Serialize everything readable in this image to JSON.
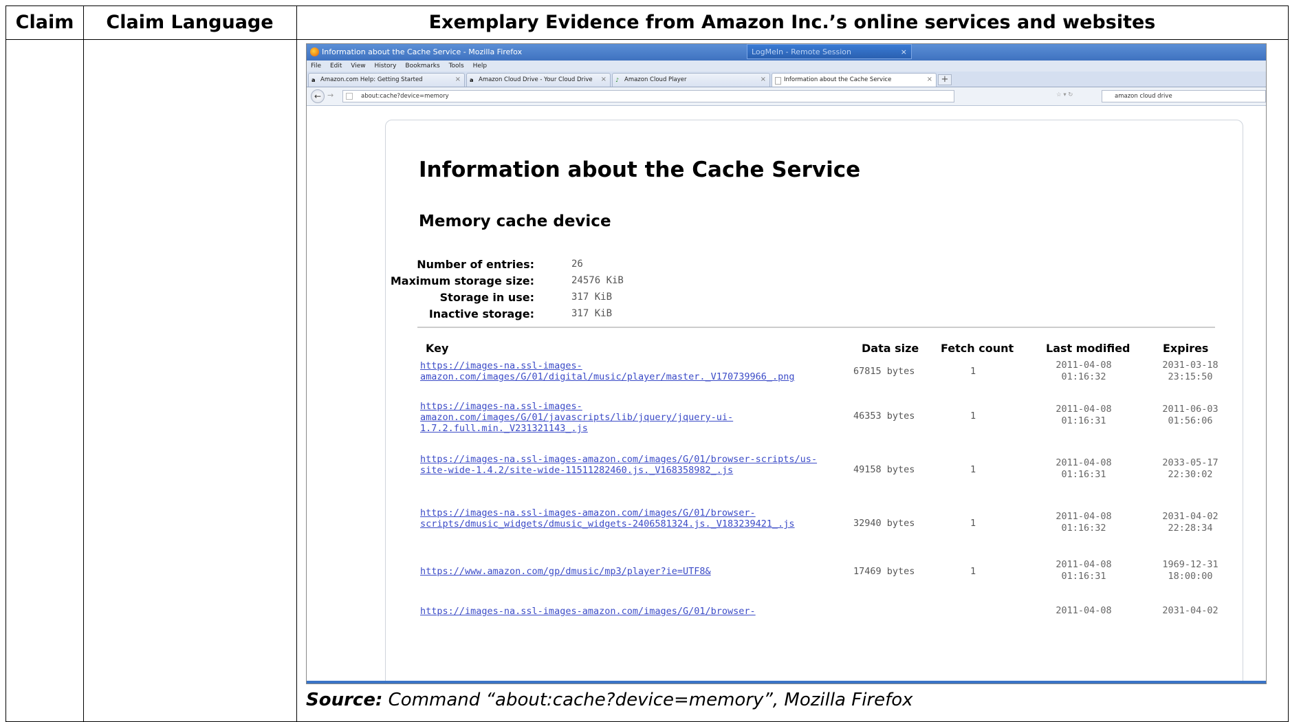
{
  "table": {
    "header": {
      "col1": "Claim",
      "col2": "Claim Language",
      "col3": "Exemplary Evidence from Amazon Inc.’s online services and websites"
    }
  },
  "browser": {
    "window_title": "Information about the Cache Service - Mozilla Firefox",
    "logmein_tab": "LogMeIn - Remote Session",
    "logmein_close": "×",
    "menu": [
      "File",
      "Edit",
      "View",
      "History",
      "Bookmarks",
      "Tools",
      "Help"
    ],
    "tabs": [
      {
        "label": "Amazon.com Help: Getting Started",
        "favicon": "a"
      },
      {
        "label": "Amazon Cloud Drive - Your Cloud Drive",
        "favicon": "a"
      },
      {
        "label": "Amazon Cloud Player",
        "favicon": "♪"
      },
      {
        "label": "Information about the Cache Service",
        "favicon": ""
      }
    ],
    "tab_close": "×",
    "new_tab": "+",
    "url": "about:cache?device=memory",
    "search_text": "amazon cloud drive"
  },
  "page": {
    "title": "Information about the Cache Service",
    "subtitle": "Memory cache device",
    "stats": [
      {
        "label": "Number of entries:",
        "value": "26"
      },
      {
        "label": "Maximum storage size:",
        "value": "24576 KiB"
      },
      {
        "label": "Storage in use:",
        "value": "317 KiB"
      },
      {
        "label": "Inactive storage:",
        "value": "317 KiB"
      }
    ],
    "columns": [
      "Key",
      "Data size",
      "Fetch count",
      "Last modified",
      "Expires"
    ],
    "rows": [
      {
        "key": "https://images-na.ssl-images-amazon.com/images/G/01/digital/music/player/master._V170739966_.png",
        "size": "67815 bytes",
        "count": "1",
        "modified": "2011-04-08 01:16:32",
        "expires": "2031-03-18 23:15:50"
      },
      {
        "key": "https://images-na.ssl-images-amazon.com/images/G/01/javascripts/lib/jquery/jquery-ui-1.7.2.full.min._V231321143_.js",
        "size": "46353 bytes",
        "count": "1",
        "modified": "2011-04-08 01:16:31",
        "expires": "2011-06-03 01:56:06"
      },
      {
        "key": "https://images-na.ssl-images-amazon.com/images/G/01/browser-scripts/us-site-wide-1.4.2/site-wide-11511282460.js._V168358982_.js",
        "size": "49158 bytes",
        "count": "1",
        "modified": "2011-04-08 01:16:31",
        "expires": "2033-05-17 22:30:02"
      },
      {
        "key": "https://images-na.ssl-images-amazon.com/images/G/01/browser-scripts/dmusic_widgets/dmusic_widgets-2406581324.js._V183239421_.js",
        "size": "32940 bytes",
        "count": "1",
        "modified": "2011-04-08 01:16:32",
        "expires": "2031-04-02 22:28:34"
      },
      {
        "key": "https://www.amazon.com/gp/dmusic/mp3/player?ie=UTF8&",
        "size": "17469 bytes",
        "count": "1",
        "modified": "2011-04-08 01:16:31",
        "expires": "1969-12-31 18:00:00"
      },
      {
        "key": "https://images-na.ssl-images-amazon.com/images/G/01/browser-",
        "size": "",
        "count": "",
        "modified": "2011-04-08",
        "expires": "2031-04-02"
      }
    ]
  },
  "source": {
    "label": "Source:",
    "text": " Command “about:cache?device=memory”, Mozilla Firefox"
  }
}
